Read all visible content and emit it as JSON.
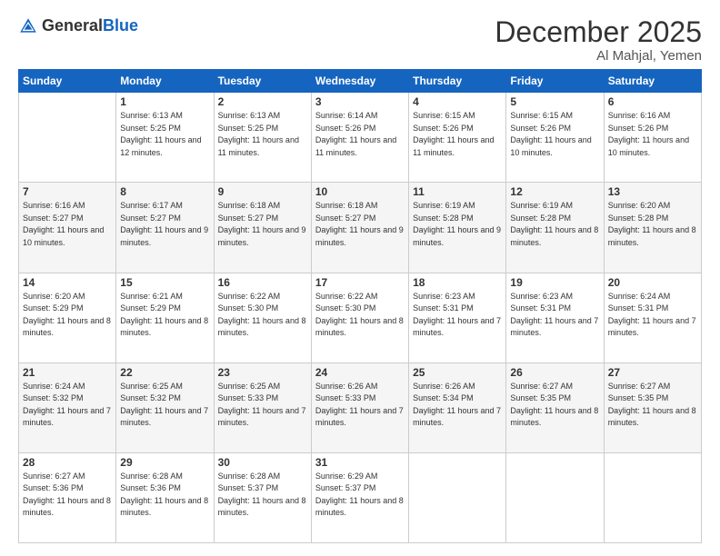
{
  "logo": {
    "general": "General",
    "blue": "Blue"
  },
  "header": {
    "month": "December 2025",
    "location": "Al Mahjal, Yemen"
  },
  "weekdays": [
    "Sunday",
    "Monday",
    "Tuesday",
    "Wednesday",
    "Thursday",
    "Friday",
    "Saturday"
  ],
  "weeks": [
    [
      null,
      {
        "day": "1",
        "sunrise": "6:13 AM",
        "sunset": "5:25 PM",
        "daylight": "11 hours and 12 minutes."
      },
      {
        "day": "2",
        "sunrise": "6:13 AM",
        "sunset": "5:25 PM",
        "daylight": "11 hours and 11 minutes."
      },
      {
        "day": "3",
        "sunrise": "6:14 AM",
        "sunset": "5:26 PM",
        "daylight": "11 hours and 11 minutes."
      },
      {
        "day": "4",
        "sunrise": "6:15 AM",
        "sunset": "5:26 PM",
        "daylight": "11 hours and 11 minutes."
      },
      {
        "day": "5",
        "sunrise": "6:15 AM",
        "sunset": "5:26 PM",
        "daylight": "11 hours and 10 minutes."
      },
      {
        "day": "6",
        "sunrise": "6:16 AM",
        "sunset": "5:26 PM",
        "daylight": "11 hours and 10 minutes."
      }
    ],
    [
      {
        "day": "7",
        "sunrise": "6:16 AM",
        "sunset": "5:27 PM",
        "daylight": "11 hours and 10 minutes."
      },
      {
        "day": "8",
        "sunrise": "6:17 AM",
        "sunset": "5:27 PM",
        "daylight": "11 hours and 9 minutes."
      },
      {
        "day": "9",
        "sunrise": "6:18 AM",
        "sunset": "5:27 PM",
        "daylight": "11 hours and 9 minutes."
      },
      {
        "day": "10",
        "sunrise": "6:18 AM",
        "sunset": "5:27 PM",
        "daylight": "11 hours and 9 minutes."
      },
      {
        "day": "11",
        "sunrise": "6:19 AM",
        "sunset": "5:28 PM",
        "daylight": "11 hours and 9 minutes."
      },
      {
        "day": "12",
        "sunrise": "6:19 AM",
        "sunset": "5:28 PM",
        "daylight": "11 hours and 8 minutes."
      },
      {
        "day": "13",
        "sunrise": "6:20 AM",
        "sunset": "5:28 PM",
        "daylight": "11 hours and 8 minutes."
      }
    ],
    [
      {
        "day": "14",
        "sunrise": "6:20 AM",
        "sunset": "5:29 PM",
        "daylight": "11 hours and 8 minutes."
      },
      {
        "day": "15",
        "sunrise": "6:21 AM",
        "sunset": "5:29 PM",
        "daylight": "11 hours and 8 minutes."
      },
      {
        "day": "16",
        "sunrise": "6:22 AM",
        "sunset": "5:30 PM",
        "daylight": "11 hours and 8 minutes."
      },
      {
        "day": "17",
        "sunrise": "6:22 AM",
        "sunset": "5:30 PM",
        "daylight": "11 hours and 8 minutes."
      },
      {
        "day": "18",
        "sunrise": "6:23 AM",
        "sunset": "5:31 PM",
        "daylight": "11 hours and 7 minutes."
      },
      {
        "day": "19",
        "sunrise": "6:23 AM",
        "sunset": "5:31 PM",
        "daylight": "11 hours and 7 minutes."
      },
      {
        "day": "20",
        "sunrise": "6:24 AM",
        "sunset": "5:31 PM",
        "daylight": "11 hours and 7 minutes."
      }
    ],
    [
      {
        "day": "21",
        "sunrise": "6:24 AM",
        "sunset": "5:32 PM",
        "daylight": "11 hours and 7 minutes."
      },
      {
        "day": "22",
        "sunrise": "6:25 AM",
        "sunset": "5:32 PM",
        "daylight": "11 hours and 7 minutes."
      },
      {
        "day": "23",
        "sunrise": "6:25 AM",
        "sunset": "5:33 PM",
        "daylight": "11 hours and 7 minutes."
      },
      {
        "day": "24",
        "sunrise": "6:26 AM",
        "sunset": "5:33 PM",
        "daylight": "11 hours and 7 minutes."
      },
      {
        "day": "25",
        "sunrise": "6:26 AM",
        "sunset": "5:34 PM",
        "daylight": "11 hours and 7 minutes."
      },
      {
        "day": "26",
        "sunrise": "6:27 AM",
        "sunset": "5:35 PM",
        "daylight": "11 hours and 8 minutes."
      },
      {
        "day": "27",
        "sunrise": "6:27 AM",
        "sunset": "5:35 PM",
        "daylight": "11 hours and 8 minutes."
      }
    ],
    [
      {
        "day": "28",
        "sunrise": "6:27 AM",
        "sunset": "5:36 PM",
        "daylight": "11 hours and 8 minutes."
      },
      {
        "day": "29",
        "sunrise": "6:28 AM",
        "sunset": "5:36 PM",
        "daylight": "11 hours and 8 minutes."
      },
      {
        "day": "30",
        "sunrise": "6:28 AM",
        "sunset": "5:37 PM",
        "daylight": "11 hours and 8 minutes."
      },
      {
        "day": "31",
        "sunrise": "6:29 AM",
        "sunset": "5:37 PM",
        "daylight": "11 hours and 8 minutes."
      },
      null,
      null,
      null
    ]
  ],
  "labels": {
    "sunrise_prefix": "Sunrise: ",
    "sunset_prefix": "Sunset: ",
    "daylight_prefix": "Daylight: "
  }
}
